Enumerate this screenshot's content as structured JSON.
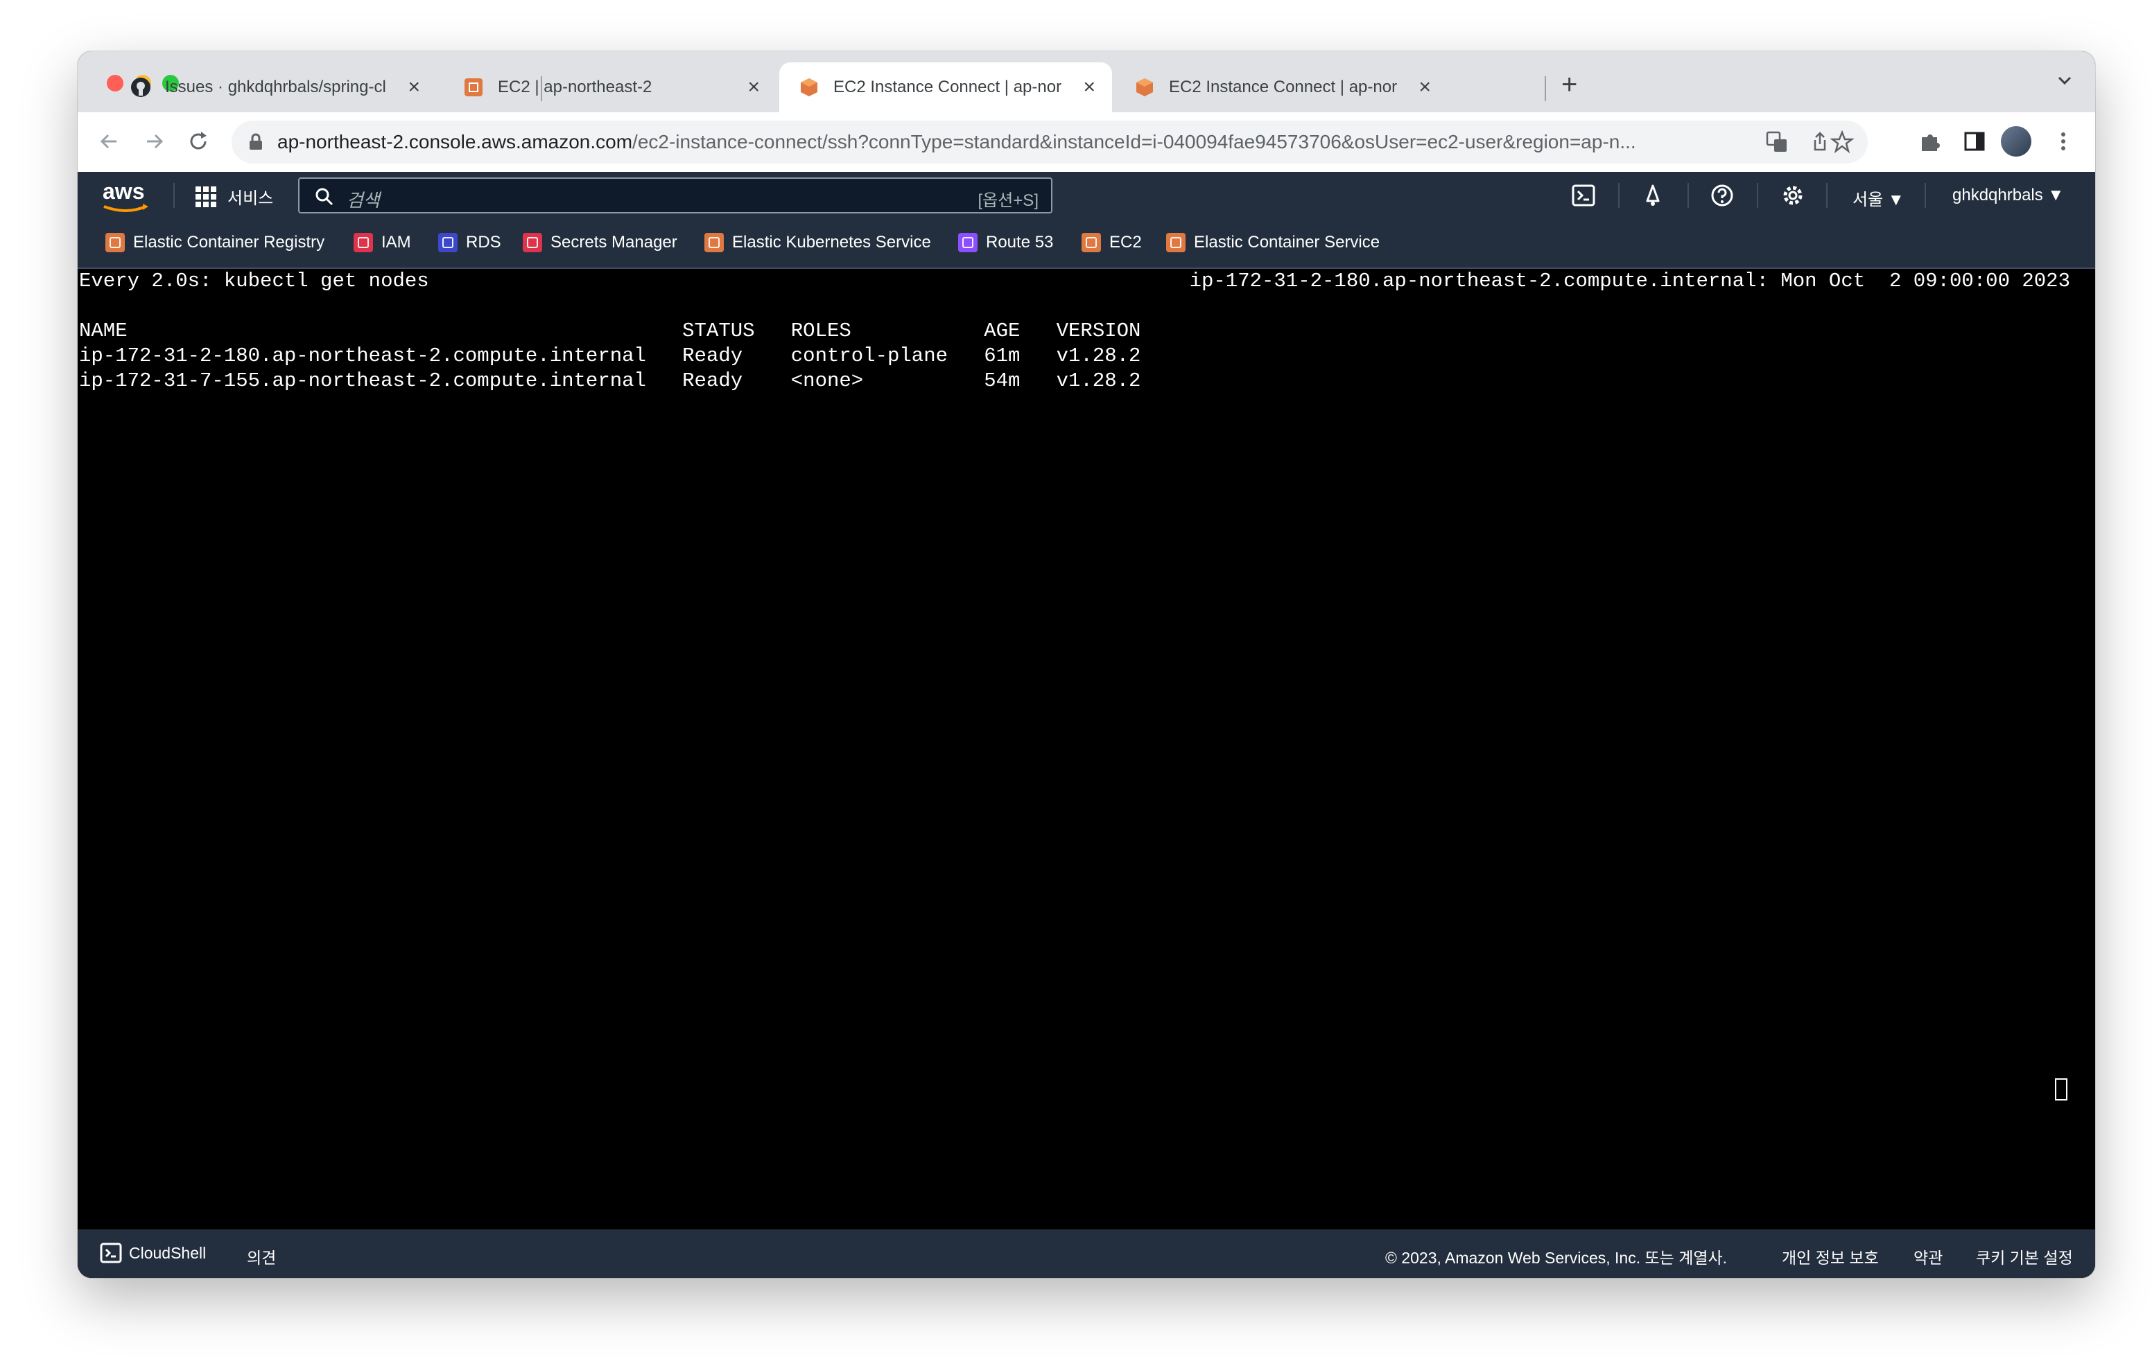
{
  "browser": {
    "tabs": [
      {
        "title": "Issues · ghkdqhrbals/spring-cl",
        "favicon": "github-icon",
        "active": false
      },
      {
        "title": "EC2 | ap-northeast-2",
        "favicon": "aws-ec2-icon",
        "active": false
      },
      {
        "title": "EC2 Instance Connect | ap-nor",
        "favicon": "aws-cube-icon",
        "active": true
      },
      {
        "title": "EC2 Instance Connect | ap-nor",
        "favicon": "aws-cube-icon",
        "active": false
      }
    ],
    "new_tab_label": "+",
    "url_host": "ap-northeast-2.console.aws.amazon.com",
    "url_path": "/ec2-instance-connect/ssh?connType=standard&instanceId=i-040094fae94573706&osUser=ec2-user&region=ap-n..."
  },
  "aws_header": {
    "logo": "aws",
    "services_label": "서비스",
    "search_placeholder": "검색",
    "search_shortcut": "[옵션+S]",
    "region": "서울 ▼",
    "account": "ghkdqhrbals ▼"
  },
  "favorites": [
    {
      "label": "Elastic Container Registry",
      "color": "#e07941"
    },
    {
      "label": "IAM",
      "color": "#dd344c"
    },
    {
      "label": "RDS",
      "color": "#3b48cc"
    },
    {
      "label": "Secrets Manager",
      "color": "#dd344c"
    },
    {
      "label": "Elastic Kubernetes Service",
      "color": "#e07941"
    },
    {
      "label": "Route 53",
      "color": "#8c4fff"
    },
    {
      "label": "EC2",
      "color": "#e07941"
    },
    {
      "label": "Elastic Container Service",
      "color": "#e07941"
    }
  ],
  "terminal": {
    "watch_line": "Every 2.0s: kubectl get nodes",
    "host_time": "ip-172-31-2-180.ap-northeast-2.compute.internal: Mon Oct  2 09:00:00 2023",
    "table_header": "NAME                                              STATUS   ROLES           AGE   VERSION",
    "rows": [
      "ip-172-31-2-180.ap-northeast-2.compute.internal   Ready    control-plane   61m   v1.28.2",
      "ip-172-31-7-155.ap-northeast-2.compute.internal   Ready    <none>          54m   v1.28.2"
    ]
  },
  "footer": {
    "cloudshell": "CloudShell",
    "feedback": "의견",
    "copyright": "© 2023, Amazon Web Services, Inc. 또는 계열사.",
    "privacy": "개인 정보 보호",
    "terms": "약관",
    "cookies": "쿠키 기본 설정"
  }
}
